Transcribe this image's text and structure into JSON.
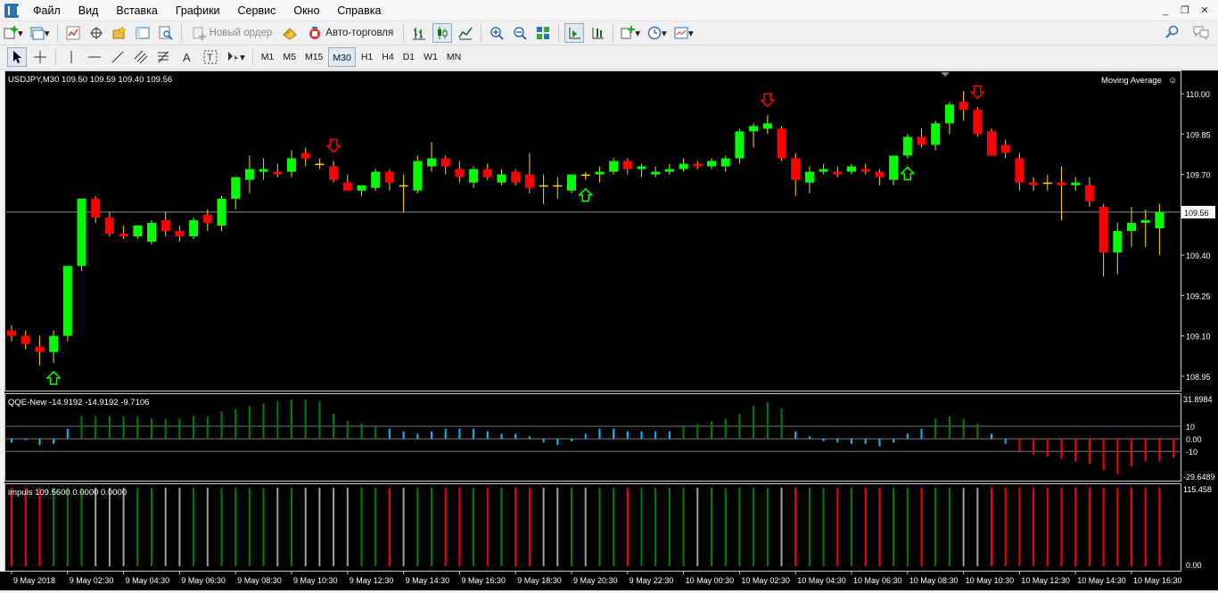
{
  "menu": [
    "Файл",
    "Вид",
    "Вставка",
    "Графики",
    "Сервис",
    "Окно",
    "Справка"
  ],
  "toolbar": {
    "new_order": "Новый ордер",
    "auto_trading": "Авто-торговля"
  },
  "timeframes": [
    "M1",
    "M5",
    "M15",
    "M30",
    "H1",
    "H4",
    "D1",
    "W1",
    "MN"
  ],
  "active_timeframe": "M30",
  "main_chart": {
    "symbol_label": "USDJPY,M30",
    "ohlc": "109.50 109.59 109.40 109.56",
    "indicator_name": "Moving Average",
    "current_price": "109.56",
    "price_ticks": [
      "110.00",
      "109.85",
      "109.70",
      "109.56",
      "109.40",
      "109.25",
      "109.10",
      "108.95"
    ]
  },
  "qqe_panel": {
    "label": "QQE-New -14.9192 -14.9192 -9.7106",
    "ticks": [
      "31.8984",
      "10",
      "0.00",
      "-10",
      "-29.6489"
    ]
  },
  "impuls_panel": {
    "label": "impuls 109.5600 0.0000 0.0000",
    "ticks": [
      "115.458",
      "0.00"
    ]
  },
  "time_labels": [
    "9 May 2018",
    "9 May 02:30",
    "9 May 04:30",
    "9 May 06:30",
    "9 May 08:30",
    "9 May 10:30",
    "9 May 12:30",
    "9 May 14:30",
    "9 May 16:30",
    "9 May 18:30",
    "9 May 20:30",
    "9 May 22:30",
    "10 May 00:30",
    "10 May 02:30",
    "10 May 04:30",
    "10 May 06:30",
    "10 May 08:30",
    "10 May 10:30",
    "10 May 12:30",
    "10 May 14:30",
    "10 May 16:30"
  ],
  "colors": {
    "bull": "#00ff00",
    "bear": "#ff0000",
    "doji": "#ffd700",
    "qqe_pos": "#008000",
    "qqe_cyan": "#00bfff",
    "qqe_neg": "#ff0000",
    "impuls_green": "#008000",
    "impuls_red": "#ff0000",
    "impuls_gray": "#a0a0a0"
  },
  "candles": [
    {
      "o": 109.12,
      "h": 109.14,
      "l": 109.08,
      "c": 109.1
    },
    {
      "o": 109.1,
      "h": 109.12,
      "l": 109.05,
      "c": 109.07
    },
    {
      "o": 109.06,
      "h": 109.1,
      "l": 108.99,
      "c": 109.04
    },
    {
      "o": 109.04,
      "h": 109.12,
      "l": 109.0,
      "c": 109.1
    },
    {
      "o": 109.1,
      "h": 109.36,
      "l": 109.08,
      "c": 109.36
    },
    {
      "o": 109.36,
      "h": 109.61,
      "l": 109.34,
      "c": 109.61
    },
    {
      "o": 109.61,
      "h": 109.62,
      "l": 109.52,
      "c": 109.54
    },
    {
      "o": 109.54,
      "h": 109.56,
      "l": 109.47,
      "c": 109.48
    },
    {
      "o": 109.48,
      "h": 109.51,
      "l": 109.46,
      "c": 109.47
    },
    {
      "o": 109.47,
      "h": 109.51,
      "l": 109.46,
      "c": 109.51
    },
    {
      "o": 109.45,
      "h": 109.53,
      "l": 109.44,
      "c": 109.52
    },
    {
      "o": 109.53,
      "h": 109.56,
      "l": 109.47,
      "c": 109.49
    },
    {
      "o": 109.49,
      "h": 109.51,
      "l": 109.45,
      "c": 109.47
    },
    {
      "o": 109.47,
      "h": 109.54,
      "l": 109.46,
      "c": 109.53
    },
    {
      "o": 109.55,
      "h": 109.57,
      "l": 109.49,
      "c": 109.52
    },
    {
      "o": 109.51,
      "h": 109.62,
      "l": 109.49,
      "c": 109.61
    },
    {
      "o": 109.61,
      "h": 109.69,
      "l": 109.57,
      "c": 109.69
    },
    {
      "o": 109.68,
      "h": 109.77,
      "l": 109.63,
      "c": 109.72
    },
    {
      "o": 109.71,
      "h": 109.76,
      "l": 109.68,
      "c": 109.72
    },
    {
      "o": 109.71,
      "h": 109.74,
      "l": 109.69,
      "c": 109.7
    },
    {
      "o": 109.71,
      "h": 109.79,
      "l": 109.69,
      "c": 109.76
    },
    {
      "o": 109.78,
      "h": 109.8,
      "l": 109.73,
      "c": 109.76
    },
    {
      "o": 109.74,
      "h": 109.76,
      "l": 109.72,
      "c": 109.74
    },
    {
      "o": 109.73,
      "h": 109.75,
      "l": 109.67,
      "c": 109.68
    },
    {
      "o": 109.67,
      "h": 109.7,
      "l": 109.64,
      "c": 109.64
    },
    {
      "o": 109.64,
      "h": 109.66,
      "l": 109.62,
      "c": 109.66
    },
    {
      "o": 109.65,
      "h": 109.72,
      "l": 109.64,
      "c": 109.71
    },
    {
      "o": 109.71,
      "h": 109.72,
      "l": 109.64,
      "c": 109.67
    },
    {
      "o": 109.66,
      "h": 109.7,
      "l": 109.56,
      "c": 109.66
    },
    {
      "o": 109.64,
      "h": 109.77,
      "l": 109.63,
      "c": 109.75
    },
    {
      "o": 109.73,
      "h": 109.82,
      "l": 109.71,
      "c": 109.76
    },
    {
      "o": 109.76,
      "h": 109.77,
      "l": 109.7,
      "c": 109.73
    },
    {
      "o": 109.72,
      "h": 109.75,
      "l": 109.67,
      "c": 109.69
    },
    {
      "o": 109.67,
      "h": 109.73,
      "l": 109.65,
      "c": 109.72
    },
    {
      "o": 109.72,
      "h": 109.74,
      "l": 109.68,
      "c": 109.69
    },
    {
      "o": 109.67,
      "h": 109.72,
      "l": 109.66,
      "c": 109.7
    },
    {
      "o": 109.71,
      "h": 109.72,
      "l": 109.66,
      "c": 109.67
    },
    {
      "o": 109.7,
      "h": 109.78,
      "l": 109.63,
      "c": 109.65
    },
    {
      "o": 109.66,
      "h": 109.7,
      "l": 109.59,
      "c": 109.66
    },
    {
      "o": 109.66,
      "h": 109.69,
      "l": 109.61,
      "c": 109.66
    },
    {
      "o": 109.64,
      "h": 109.7,
      "l": 109.63,
      "c": 109.7
    },
    {
      "o": 109.7,
      "h": 109.71,
      "l": 109.68,
      "c": 109.7
    },
    {
      "o": 109.7,
      "h": 109.73,
      "l": 109.67,
      "c": 109.71
    },
    {
      "o": 109.71,
      "h": 109.76,
      "l": 109.7,
      "c": 109.75
    },
    {
      "o": 109.75,
      "h": 109.76,
      "l": 109.7,
      "c": 109.72
    },
    {
      "o": 109.72,
      "h": 109.74,
      "l": 109.69,
      "c": 109.73
    },
    {
      "o": 109.7,
      "h": 109.73,
      "l": 109.69,
      "c": 109.71
    },
    {
      "o": 109.71,
      "h": 109.74,
      "l": 109.7,
      "c": 109.72
    },
    {
      "o": 109.72,
      "h": 109.76,
      "l": 109.71,
      "c": 109.74
    },
    {
      "o": 109.74,
      "h": 109.75,
      "l": 109.72,
      "c": 109.73
    },
    {
      "o": 109.73,
      "h": 109.76,
      "l": 109.72,
      "c": 109.75
    },
    {
      "o": 109.73,
      "h": 109.77,
      "l": 109.71,
      "c": 109.76
    },
    {
      "o": 109.76,
      "h": 109.87,
      "l": 109.74,
      "c": 109.86
    },
    {
      "o": 109.86,
      "h": 109.89,
      "l": 109.8,
      "c": 109.88
    },
    {
      "o": 109.87,
      "h": 109.92,
      "l": 109.85,
      "c": 109.89
    },
    {
      "o": 109.87,
      "h": 109.88,
      "l": 109.75,
      "c": 109.76
    },
    {
      "o": 109.76,
      "h": 109.78,
      "l": 109.62,
      "c": 109.68
    },
    {
      "o": 109.67,
      "h": 109.73,
      "l": 109.63,
      "c": 109.71
    },
    {
      "o": 109.71,
      "h": 109.74,
      "l": 109.7,
      "c": 109.72
    },
    {
      "o": 109.71,
      "h": 109.73,
      "l": 109.69,
      "c": 109.7
    },
    {
      "o": 109.71,
      "h": 109.74,
      "l": 109.7,
      "c": 109.73
    },
    {
      "o": 109.72,
      "h": 109.74,
      "l": 109.7,
      "c": 109.71
    },
    {
      "o": 109.71,
      "h": 109.72,
      "l": 109.66,
      "c": 109.69
    },
    {
      "o": 109.68,
      "h": 109.77,
      "l": 109.66,
      "c": 109.77
    },
    {
      "o": 109.77,
      "h": 109.85,
      "l": 109.76,
      "c": 109.84
    },
    {
      "o": 109.84,
      "h": 109.87,
      "l": 109.8,
      "c": 109.81
    },
    {
      "o": 109.81,
      "h": 109.9,
      "l": 109.79,
      "c": 109.89
    },
    {
      "o": 109.89,
      "h": 109.97,
      "l": 109.85,
      "c": 109.96
    },
    {
      "o": 109.97,
      "h": 110.01,
      "l": 109.9,
      "c": 109.94
    },
    {
      "o": 109.94,
      "h": 109.95,
      "l": 109.84,
      "c": 109.85
    },
    {
      "o": 109.86,
      "h": 109.87,
      "l": 109.77,
      "c": 109.77
    },
    {
      "o": 109.81,
      "h": 109.83,
      "l": 109.76,
      "c": 109.78
    },
    {
      "o": 109.76,
      "h": 109.78,
      "l": 109.64,
      "c": 109.67
    },
    {
      "o": 109.67,
      "h": 109.69,
      "l": 109.64,
      "c": 109.66
    },
    {
      "o": 109.67,
      "h": 109.7,
      "l": 109.64,
      "c": 109.67
    },
    {
      "o": 109.67,
      "h": 109.73,
      "l": 109.53,
      "c": 109.66
    },
    {
      "o": 109.66,
      "h": 109.69,
      "l": 109.64,
      "c": 109.67
    },
    {
      "o": 109.66,
      "h": 109.69,
      "l": 109.58,
      "c": 109.6
    },
    {
      "o": 109.58,
      "h": 109.59,
      "l": 109.32,
      "c": 109.41
    },
    {
      "o": 109.41,
      "h": 109.52,
      "l": 109.33,
      "c": 109.49
    },
    {
      "o": 109.49,
      "h": 109.58,
      "l": 109.43,
      "c": 109.52
    },
    {
      "o": 109.52,
      "h": 109.57,
      "l": 109.43,
      "c": 109.53
    },
    {
      "o": 109.5,
      "h": 109.59,
      "l": 109.4,
      "c": 109.56
    }
  ],
  "signals": [
    {
      "i": 3,
      "dir": "up",
      "color": "#00ff00"
    },
    {
      "i": 23,
      "dir": "down",
      "color": "#ff0000"
    },
    {
      "i": 41,
      "dir": "up",
      "color": "#00ff00"
    },
    {
      "i": 54,
      "dir": "down",
      "color": "#ff0000"
    },
    {
      "i": 64,
      "dir": "up",
      "color": "#00ff00"
    },
    {
      "i": 69,
      "dir": "down",
      "color": "#ff0000"
    }
  ],
  "qqe_values": [
    -3,
    -1,
    -5,
    -4,
    8,
    18,
    18,
    18,
    18,
    18,
    16,
    16,
    16,
    18,
    18,
    22,
    24,
    26,
    28,
    30,
    31,
    31,
    30,
    20,
    14,
    12,
    10,
    8,
    6,
    4,
    6,
    8,
    8,
    8,
    6,
    4,
    4,
    2,
    -3,
    -5,
    -2,
    4,
    8,
    8,
    6,
    6,
    6,
    6,
    10,
    12,
    14,
    16,
    20,
    26,
    29,
    24,
    6,
    2,
    -2,
    -3,
    -4,
    -4,
    -6,
    -3,
    4,
    8,
    16,
    18,
    16,
    12,
    4,
    -4,
    -10,
    -12,
    -14,
    -16,
    -18,
    -20,
    -25,
    -28,
    -22,
    -18,
    -18,
    -15
  ]
}
